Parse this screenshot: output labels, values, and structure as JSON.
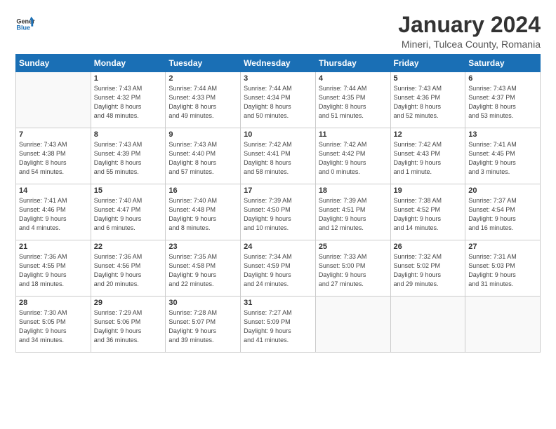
{
  "logo": {
    "line1": "General",
    "line2": "Blue"
  },
  "title": "January 2024",
  "subtitle": "Mineri, Tulcea County, Romania",
  "days_of_week": [
    "Sunday",
    "Monday",
    "Tuesday",
    "Wednesday",
    "Thursday",
    "Friday",
    "Saturday"
  ],
  "weeks": [
    [
      {
        "num": "",
        "info": ""
      },
      {
        "num": "1",
        "info": "Sunrise: 7:43 AM\nSunset: 4:32 PM\nDaylight: 8 hours\nand 48 minutes."
      },
      {
        "num": "2",
        "info": "Sunrise: 7:44 AM\nSunset: 4:33 PM\nDaylight: 8 hours\nand 49 minutes."
      },
      {
        "num": "3",
        "info": "Sunrise: 7:44 AM\nSunset: 4:34 PM\nDaylight: 8 hours\nand 50 minutes."
      },
      {
        "num": "4",
        "info": "Sunrise: 7:44 AM\nSunset: 4:35 PM\nDaylight: 8 hours\nand 51 minutes."
      },
      {
        "num": "5",
        "info": "Sunrise: 7:43 AM\nSunset: 4:36 PM\nDaylight: 8 hours\nand 52 minutes."
      },
      {
        "num": "6",
        "info": "Sunrise: 7:43 AM\nSunset: 4:37 PM\nDaylight: 8 hours\nand 53 minutes."
      }
    ],
    [
      {
        "num": "7",
        "info": "Sunrise: 7:43 AM\nSunset: 4:38 PM\nDaylight: 8 hours\nand 54 minutes."
      },
      {
        "num": "8",
        "info": "Sunrise: 7:43 AM\nSunset: 4:39 PM\nDaylight: 8 hours\nand 55 minutes."
      },
      {
        "num": "9",
        "info": "Sunrise: 7:43 AM\nSunset: 4:40 PM\nDaylight: 8 hours\nand 57 minutes."
      },
      {
        "num": "10",
        "info": "Sunrise: 7:42 AM\nSunset: 4:41 PM\nDaylight: 8 hours\nand 58 minutes."
      },
      {
        "num": "11",
        "info": "Sunrise: 7:42 AM\nSunset: 4:42 PM\nDaylight: 9 hours\nand 0 minutes."
      },
      {
        "num": "12",
        "info": "Sunrise: 7:42 AM\nSunset: 4:43 PM\nDaylight: 9 hours\nand 1 minute."
      },
      {
        "num": "13",
        "info": "Sunrise: 7:41 AM\nSunset: 4:45 PM\nDaylight: 9 hours\nand 3 minutes."
      }
    ],
    [
      {
        "num": "14",
        "info": "Sunrise: 7:41 AM\nSunset: 4:46 PM\nDaylight: 9 hours\nand 4 minutes."
      },
      {
        "num": "15",
        "info": "Sunrise: 7:40 AM\nSunset: 4:47 PM\nDaylight: 9 hours\nand 6 minutes."
      },
      {
        "num": "16",
        "info": "Sunrise: 7:40 AM\nSunset: 4:48 PM\nDaylight: 9 hours\nand 8 minutes."
      },
      {
        "num": "17",
        "info": "Sunrise: 7:39 AM\nSunset: 4:50 PM\nDaylight: 9 hours\nand 10 minutes."
      },
      {
        "num": "18",
        "info": "Sunrise: 7:39 AM\nSunset: 4:51 PM\nDaylight: 9 hours\nand 12 minutes."
      },
      {
        "num": "19",
        "info": "Sunrise: 7:38 AM\nSunset: 4:52 PM\nDaylight: 9 hours\nand 14 minutes."
      },
      {
        "num": "20",
        "info": "Sunrise: 7:37 AM\nSunset: 4:54 PM\nDaylight: 9 hours\nand 16 minutes."
      }
    ],
    [
      {
        "num": "21",
        "info": "Sunrise: 7:36 AM\nSunset: 4:55 PM\nDaylight: 9 hours\nand 18 minutes."
      },
      {
        "num": "22",
        "info": "Sunrise: 7:36 AM\nSunset: 4:56 PM\nDaylight: 9 hours\nand 20 minutes."
      },
      {
        "num": "23",
        "info": "Sunrise: 7:35 AM\nSunset: 4:58 PM\nDaylight: 9 hours\nand 22 minutes."
      },
      {
        "num": "24",
        "info": "Sunrise: 7:34 AM\nSunset: 4:59 PM\nDaylight: 9 hours\nand 24 minutes."
      },
      {
        "num": "25",
        "info": "Sunrise: 7:33 AM\nSunset: 5:00 PM\nDaylight: 9 hours\nand 27 minutes."
      },
      {
        "num": "26",
        "info": "Sunrise: 7:32 AM\nSunset: 5:02 PM\nDaylight: 9 hours\nand 29 minutes."
      },
      {
        "num": "27",
        "info": "Sunrise: 7:31 AM\nSunset: 5:03 PM\nDaylight: 9 hours\nand 31 minutes."
      }
    ],
    [
      {
        "num": "28",
        "info": "Sunrise: 7:30 AM\nSunset: 5:05 PM\nDaylight: 9 hours\nand 34 minutes."
      },
      {
        "num": "29",
        "info": "Sunrise: 7:29 AM\nSunset: 5:06 PM\nDaylight: 9 hours\nand 36 minutes."
      },
      {
        "num": "30",
        "info": "Sunrise: 7:28 AM\nSunset: 5:07 PM\nDaylight: 9 hours\nand 39 minutes."
      },
      {
        "num": "31",
        "info": "Sunrise: 7:27 AM\nSunset: 5:09 PM\nDaylight: 9 hours\nand 41 minutes."
      },
      {
        "num": "",
        "info": ""
      },
      {
        "num": "",
        "info": ""
      },
      {
        "num": "",
        "info": ""
      }
    ]
  ]
}
